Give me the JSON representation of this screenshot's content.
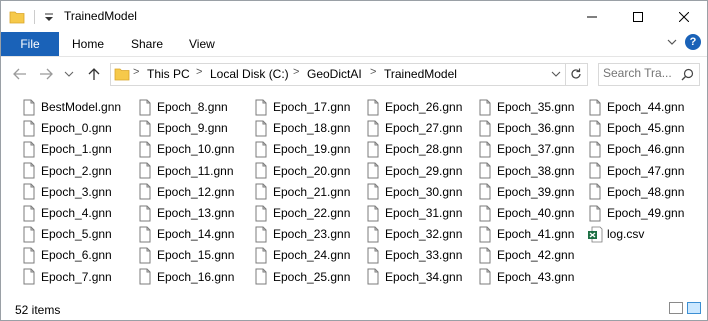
{
  "window": {
    "title": "TrainedModel"
  },
  "ribbon": {
    "file": "File",
    "tabs": [
      "Home",
      "Share",
      "View"
    ]
  },
  "address": {
    "crumbs": [
      "This PC",
      "Local Disk (C:)",
      "GeoDictAI",
      "TrainedModel"
    ]
  },
  "search": {
    "placeholder": "Search Tra..."
  },
  "files": [
    "BestModel.gnn",
    "Epoch_0.gnn",
    "Epoch_1.gnn",
    "Epoch_2.gnn",
    "Epoch_3.gnn",
    "Epoch_4.gnn",
    "Epoch_5.gnn",
    "Epoch_6.gnn",
    "Epoch_7.gnn",
    "Epoch_8.gnn",
    "Epoch_9.gnn",
    "Epoch_10.gnn",
    "Epoch_11.gnn",
    "Epoch_12.gnn",
    "Epoch_13.gnn",
    "Epoch_14.gnn",
    "Epoch_15.gnn",
    "Epoch_16.gnn",
    "Epoch_17.gnn",
    "Epoch_18.gnn",
    "Epoch_19.gnn",
    "Epoch_20.gnn",
    "Epoch_21.gnn",
    "Epoch_22.gnn",
    "Epoch_23.gnn",
    "Epoch_24.gnn",
    "Epoch_25.gnn",
    "Epoch_26.gnn",
    "Epoch_27.gnn",
    "Epoch_28.gnn",
    "Epoch_29.gnn",
    "Epoch_30.gnn",
    "Epoch_31.gnn",
    "Epoch_32.gnn",
    "Epoch_33.gnn",
    "Epoch_34.gnn",
    "Epoch_35.gnn",
    "Epoch_36.gnn",
    "Epoch_37.gnn",
    "Epoch_38.gnn",
    "Epoch_39.gnn",
    "Epoch_40.gnn",
    "Epoch_41.gnn",
    "Epoch_42.gnn",
    "Epoch_43.gnn",
    "Epoch_44.gnn",
    "Epoch_45.gnn",
    "Epoch_46.gnn",
    "Epoch_47.gnn",
    "Epoch_48.gnn",
    "Epoch_49.gnn",
    "log.csv"
  ],
  "status": {
    "items": "52 items"
  },
  "colors": {
    "accent": "#1a62b8",
    "folder": "#f6c94a",
    "excel": "#1d7044"
  },
  "icons": {
    "document": "document-icon",
    "spreadsheet": "excel-icon",
    "folder": "folder-icon"
  }
}
